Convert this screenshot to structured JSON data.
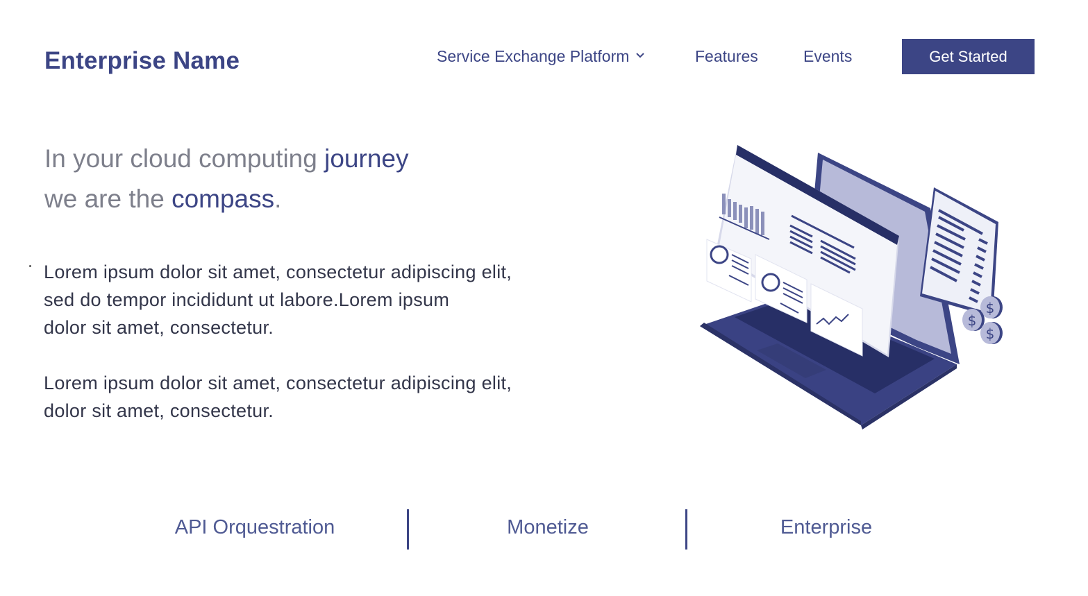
{
  "brand": {
    "name": "Enterprise Name"
  },
  "nav": {
    "items": [
      {
        "label": "Service Exchange Platform",
        "has_dropdown": true
      },
      {
        "label": "Features"
      },
      {
        "label": "Events"
      }
    ],
    "cta_label": "Get Started"
  },
  "hero": {
    "headline": {
      "line1_prefix": "In your cloud computing ",
      "line1_emphasis": "journey",
      "line2_prefix": "we are the ",
      "line2_emphasis": "compass",
      "line2_suffix": "."
    },
    "paragraph1_lines": [
      "Lorem ipsum dolor sit amet, consectetur adipiscing elit,",
      "sed do tempor incididunt ut labore.Lorem ipsum",
      "dolor sit amet, consectetur."
    ],
    "paragraph2_lines": [
      "Lorem ipsum dolor sit amet, consectetur adipiscing elit,",
      "dolor sit amet, consectetur."
    ],
    "illustration_icon": "laptop-dashboard-illustration"
  },
  "tabs": [
    {
      "label": "API Orquestration"
    },
    {
      "label": "Monetize"
    },
    {
      "label": "Enterprise"
    }
  ],
  "colors": {
    "brand": "#3c4585",
    "headline_muted": "#7d7f8b",
    "body_text": "#33364a",
    "tab_text": "#4f5a93",
    "background": "#ffffff"
  }
}
